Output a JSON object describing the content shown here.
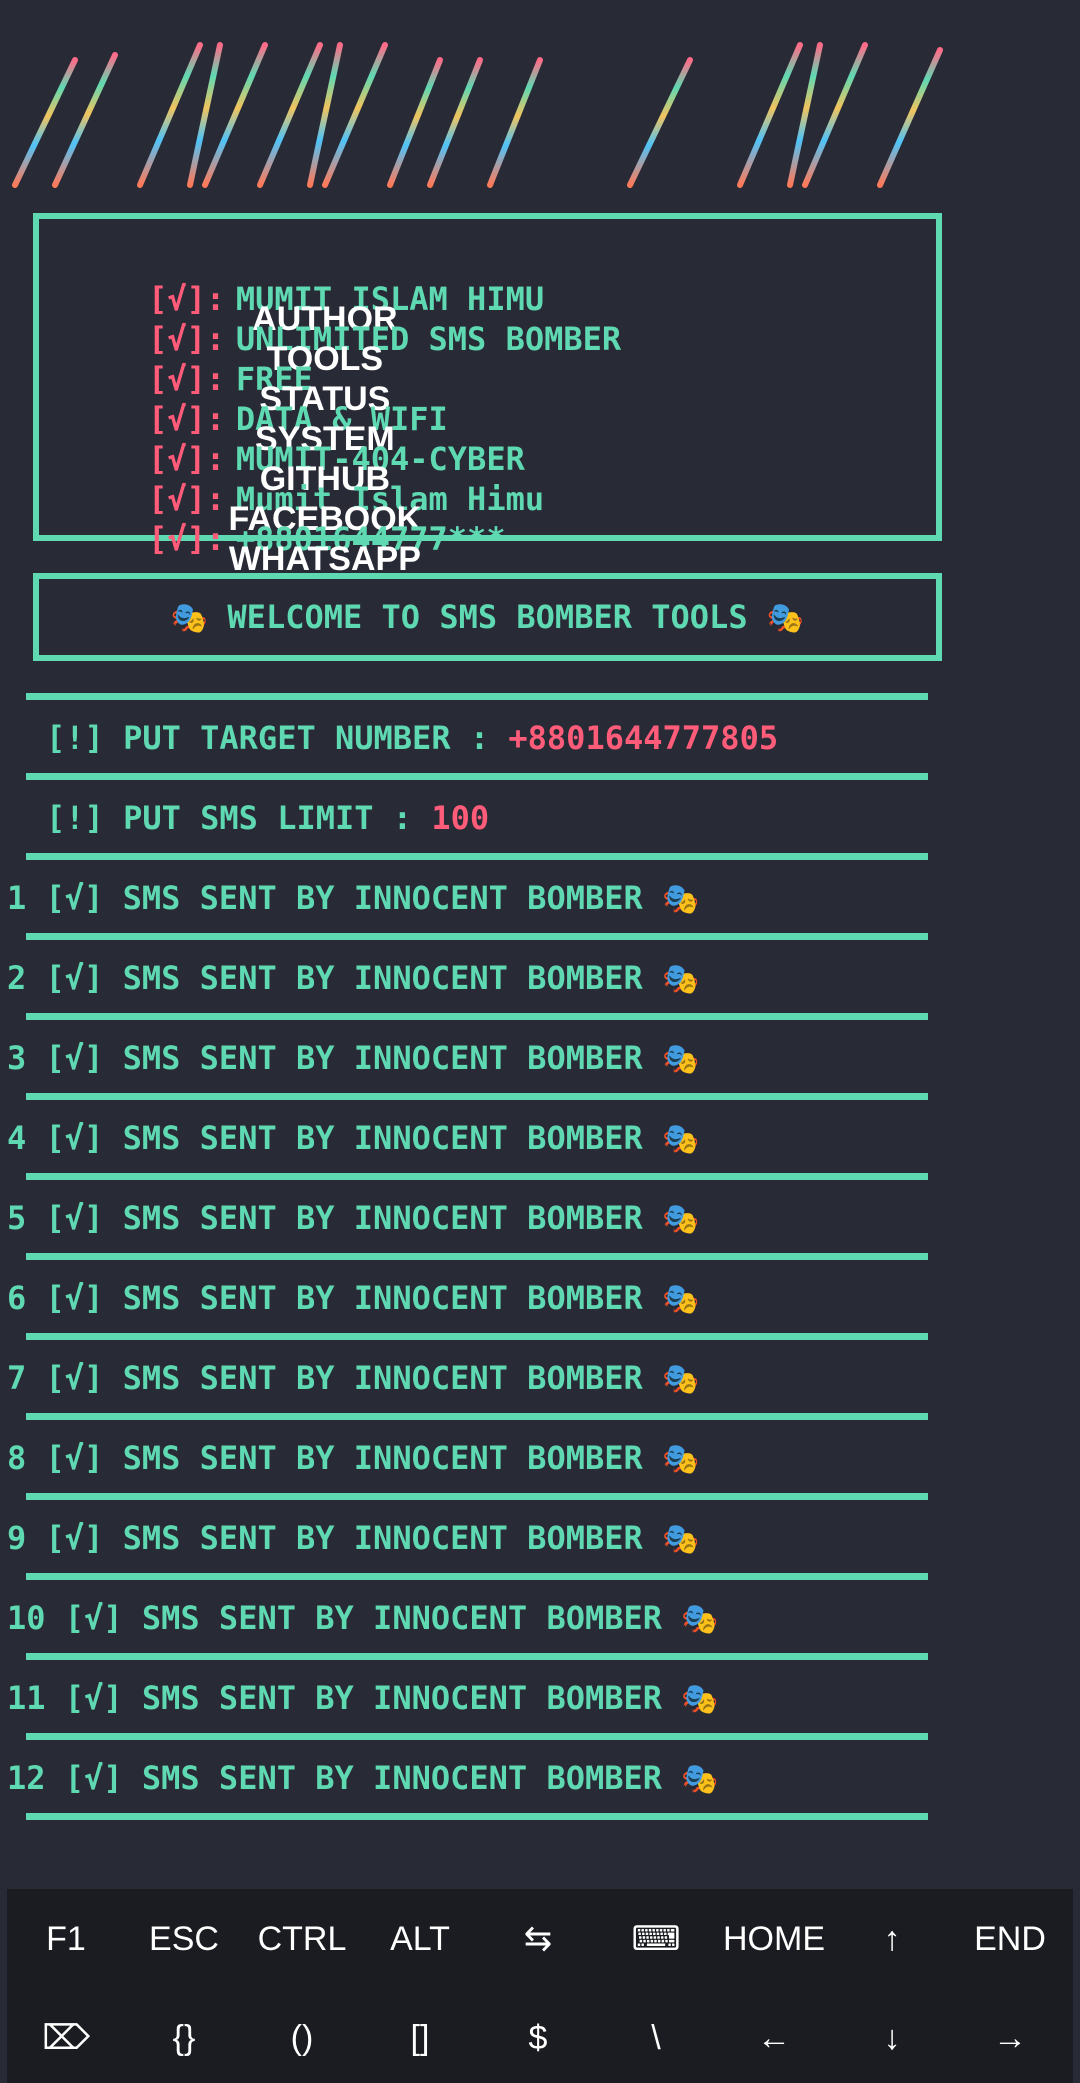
{
  "banner": {
    "text": "INNOCENT"
  },
  "info": {
    "rows": [
      {
        "check": "[√]",
        "key": "AUTHOR",
        "colon": ":",
        "value": "MUMIT ISLAM HIMU"
      },
      {
        "check": "[√]",
        "key": "TOOLS",
        "colon": ":",
        "value": "UNLIMITED SMS BOMBER"
      },
      {
        "check": "[√]",
        "key": "STATUS",
        "colon": ":",
        "value": "FREE"
      },
      {
        "check": "[√]",
        "key": "SYSTEM",
        "colon": ":",
        "value": "DATA & WIFI"
      },
      {
        "check": "[√]",
        "key": "GITHUB",
        "colon": ":",
        "value": "MUMIT-404-CYBER"
      },
      {
        "check": "[√]",
        "key": "FACEBOOK",
        "colon": ":",
        "value": "Mumit Islam Himu"
      },
      {
        "check": "[√]",
        "key": "WHATSAPP",
        "colon": ":",
        "value": "+8801644777***"
      }
    ]
  },
  "welcome": {
    "mask_left": "🎭",
    "text": "WELCOME TO SMS BOMBER TOOLS",
    "mask_right": "🎭"
  },
  "prompts": {
    "target_label": "[!] PUT TARGET NUMBER : ",
    "target_value": "+8801644777805",
    "limit_label": "[!] PUT SMS LIMIT : ",
    "limit_value": "100"
  },
  "sent": {
    "check": "[√]",
    "message": "SMS SENT BY INNOCENT BOMBER",
    "mask": "🎭",
    "numbers": [
      "1",
      "2",
      "3",
      "4",
      "5",
      "6",
      "7",
      "8",
      "9",
      "10",
      "11",
      "12"
    ]
  },
  "keyboard": {
    "row1": [
      "F1",
      "ESC",
      "CTRL",
      "ALT",
      "⇆",
      "⌨",
      "HOME",
      "↑",
      "END"
    ],
    "row2": [
      "⌦",
      "{}",
      "()",
      "[]",
      "$",
      "\\",
      "←",
      "↓",
      "→"
    ]
  },
  "colors": {
    "bg": "#282a36",
    "green": "#5fd9b2",
    "pink": "#ff5c7a",
    "yellow": "#f1c45e",
    "blue": "#4fc3f7",
    "orange": "#ff7a59"
  }
}
